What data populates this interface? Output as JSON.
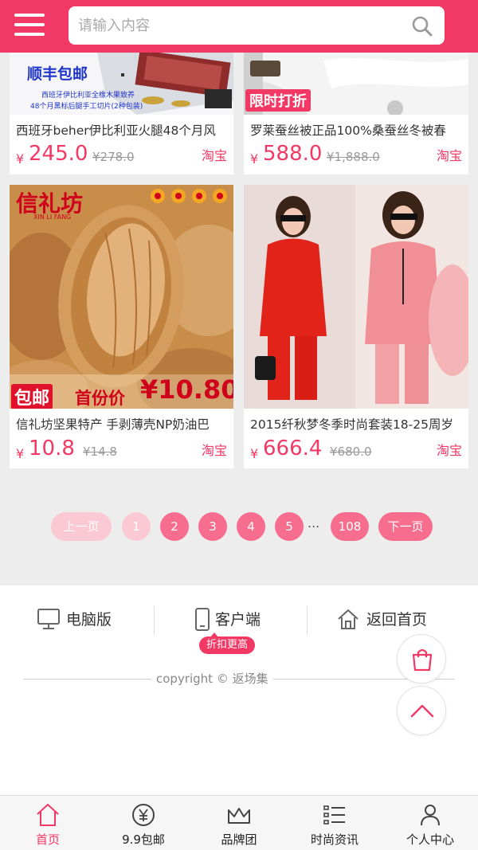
{
  "header": {
    "search_placeholder": "请输入内容"
  },
  "products": [
    {
      "title": "西班牙beher伊比利亚火腿48个月风",
      "currency": "¥",
      "price": "245.0",
      "old_price": "¥278.0",
      "source": "淘宝",
      "image_text": {
        "shipping": "顺丰包邮",
        "desc_line1": "西班牙伊比利亚全橡木果致养",
        "desc_line2": "48个月黑标后腿手工切片(2种包装)"
      }
    },
    {
      "title": "罗莱蚕丝被正品100%桑蚕丝冬被春",
      "currency": "¥",
      "price": "588.0",
      "old_price": "¥1,888.0",
      "source": "淘宝",
      "image_text": {
        "promo": "限时打折"
      }
    },
    {
      "title": "信礼坊坚果特产 手剥薄壳NP奶油巴",
      "currency": "¥",
      "price": "10.8",
      "old_price": "¥14.8",
      "source": "淘宝",
      "image_text": {
        "brand": "信礼坊",
        "brand_pinyin": "XIN LI FANG",
        "shipping": "包邮",
        "first_price_label": "首份价",
        "first_price": "¥10.80"
      }
    },
    {
      "title": "2015纤秋梦冬季时尚套装18-25周岁",
      "currency": "¥",
      "price": "666.4",
      "old_price": "¥680.0",
      "source": "淘宝"
    }
  ],
  "pagination": {
    "prev": "上一页",
    "pages": [
      "1",
      "2",
      "3",
      "4",
      "5"
    ],
    "ellipsis": "...",
    "last": "108",
    "next": "下一页"
  },
  "footer": {
    "desktop": "电脑版",
    "client": "客户端",
    "client_badge": "折扣更高",
    "home": "返回首页",
    "copyright": "copyright © 返场集"
  },
  "bottom_nav": [
    {
      "label": "首页",
      "icon": "home-icon",
      "active": true
    },
    {
      "label": "9.9包邮",
      "icon": "yen-circle-icon",
      "active": false
    },
    {
      "label": "品牌团",
      "icon": "crown-icon",
      "active": false
    },
    {
      "label": "时尚资讯",
      "icon": "list-icon",
      "active": false
    },
    {
      "label": "个人中心",
      "icon": "user-icon",
      "active": false
    }
  ],
  "colors": {
    "brand": "#f23864",
    "pager_active": "#f66d8d",
    "pager_light": "#fbc9d4"
  }
}
